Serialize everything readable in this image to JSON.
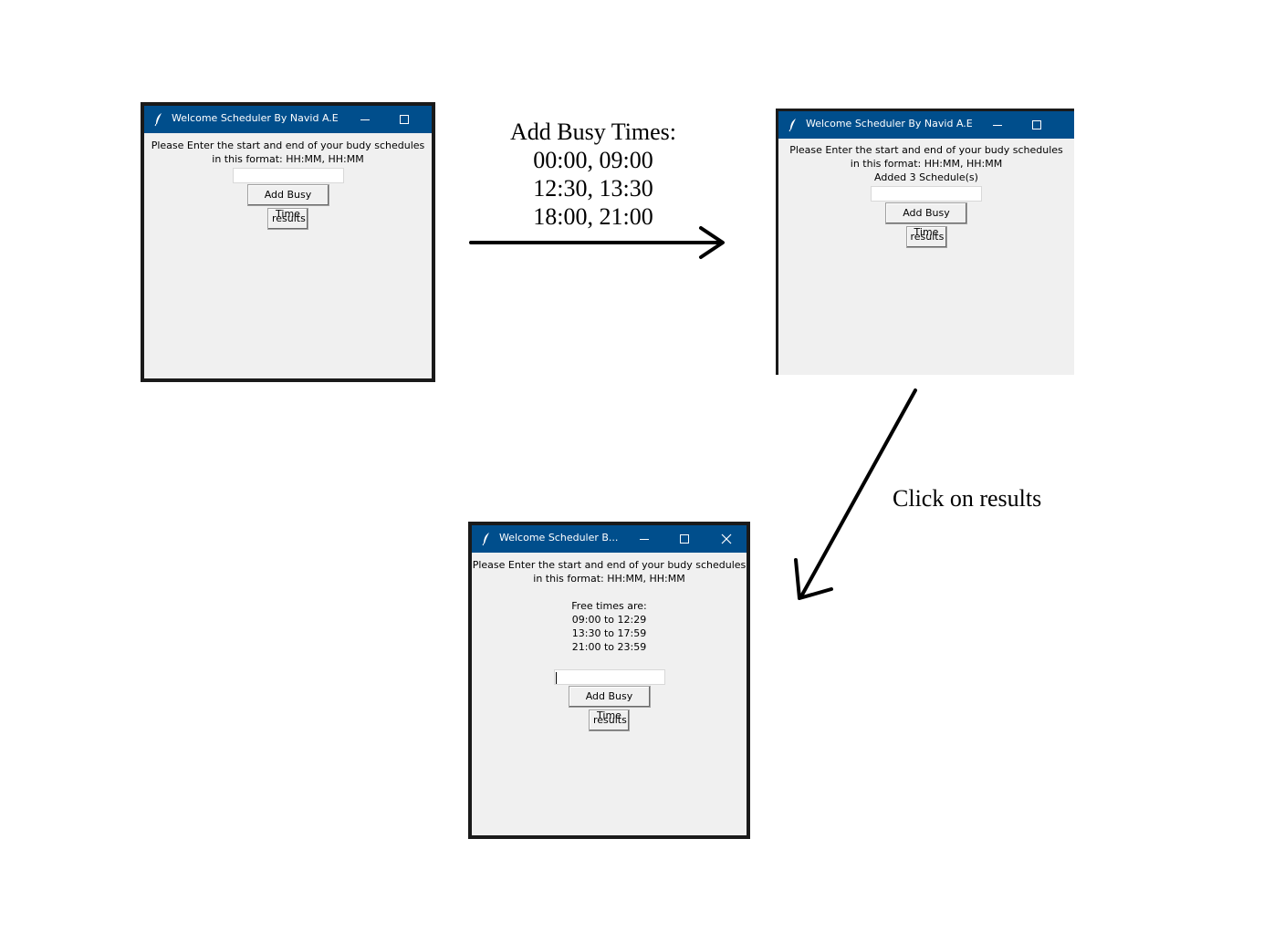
{
  "window_title": "Welcome Scheduler By Navid A.E",
  "window_title_truncated": "Welcome Scheduler B...",
  "prompt_line1": "Please Enter the start and end of your budy schedules",
  "prompt_line2": "in this format: HH:MM, HH:MM",
  "add_button_label": "Add Busy Time",
  "results_button_label": "results",
  "added_message": "Added 3 Schedule(s)",
  "free_times": {
    "header": "Free times are:",
    "items": [
      "09:00 to 12:29",
      "13:30 to 17:59",
      "21:00 to 23:59"
    ]
  },
  "annotation_busy": {
    "heading": "Add Busy Times:",
    "lines": [
      "00:00, 09:00",
      "12:30, 13:30",
      "18:00, 21:00"
    ]
  },
  "annotation_click": "Click on results",
  "icons": {
    "app": "feather-icon",
    "minimize": "minimize-icon",
    "maximize": "maximize-icon",
    "close": "close-icon"
  },
  "colors": {
    "titlebar": "#004e8c",
    "window_bg": "#f0f0f0",
    "frame": "#1a1a1a"
  }
}
